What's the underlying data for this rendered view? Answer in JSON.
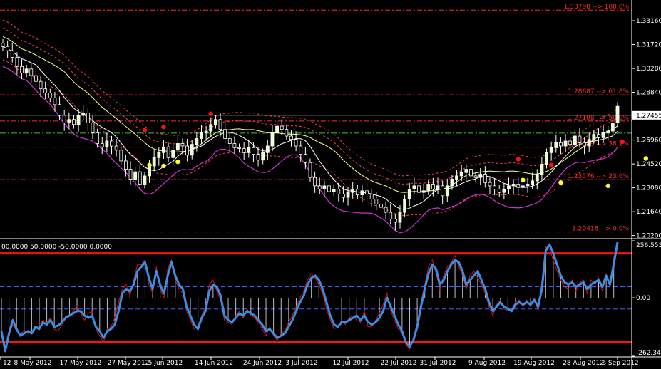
{
  "chart_data": [
    {
      "type": "candlestick",
      "panel": "price",
      "y_ticks": [
        "1.33160",
        "1.31720",
        "1.30280",
        "1.28840",
        "1.27455",
        "1.25960",
        "1.24520",
        "1.23080",
        "1.21640",
        "1.20200"
      ],
      "ylim": [
        1.201,
        1.3415
      ],
      "current_price": 1.27455,
      "fib_levels": [
        {
          "value": 1.33798,
          "label": "1.33798 --> 100.0%"
        },
        {
          "value": 1.28687,
          "label": "1.28687 --> 61.8%"
        },
        {
          "value": 1.27108,
          "label": "1.27108 --> 50.0%"
        },
        {
          "value": 1.25529,
          "label": "1.25529 --> 38.2%"
        },
        {
          "value": 1.23576,
          "label": "1.23576 --> 23.6%"
        },
        {
          "value": 1.20418,
          "label": "1.20418 --> 0.0%"
        }
      ],
      "close": [
        1.316,
        1.3135,
        1.3095,
        1.304,
        1.3,
        1.3025,
        1.2985,
        1.295,
        1.2905,
        1.288,
        1.285,
        1.281,
        1.2745,
        1.27,
        1.272,
        1.269,
        1.2745,
        1.276,
        1.27,
        1.264,
        1.2575,
        1.2555,
        1.259,
        1.256,
        1.2535,
        1.247,
        1.242,
        1.236,
        1.2405,
        1.233,
        1.238,
        1.244,
        1.249,
        1.252,
        1.2555,
        1.249,
        1.2535,
        1.2575,
        1.256,
        1.2505,
        1.257,
        1.2605,
        1.264,
        1.265,
        1.269,
        1.272,
        1.266,
        1.2605,
        1.2575,
        1.255,
        1.2545,
        1.252,
        1.255,
        1.251,
        1.2475,
        1.252,
        1.256,
        1.264,
        1.268,
        1.266,
        1.262,
        1.26,
        1.256,
        1.251,
        1.246,
        1.237,
        1.232,
        1.23,
        1.232,
        1.2285,
        1.23,
        1.227,
        1.225,
        1.228,
        1.23,
        1.2265,
        1.229,
        1.227,
        1.224,
        1.221,
        1.219,
        1.216,
        1.212,
        1.21,
        1.216,
        1.224,
        1.23,
        1.232,
        1.228,
        1.229,
        1.233,
        1.23,
        1.232,
        1.226,
        1.232,
        1.236,
        1.238,
        1.24,
        1.242,
        1.238,
        1.237,
        1.239,
        1.234,
        1.232,
        1.23,
        1.228,
        1.23,
        1.232,
        1.233,
        1.231,
        1.232,
        1.233,
        1.235,
        1.239,
        1.245,
        1.252,
        1.255,
        1.258,
        1.256,
        1.259,
        1.257,
        1.262,
        1.258,
        1.256,
        1.26,
        1.263,
        1.261,
        1.264,
        1.265,
        1.27,
        1.28
      ],
      "markers": {
        "red": [
          [
            30,
            1.2655
          ],
          [
            34,
            1.2675
          ],
          [
            44,
            1.2755
          ],
          [
            109,
            1.248
          ],
          [
            116,
            1.2445
          ],
          [
            131,
            1.2585
          ]
        ],
        "yellow": [
          [
            31,
            1.2445
          ],
          [
            34,
            1.244
          ],
          [
            37,
            1.2465
          ],
          [
            110,
            1.2355
          ],
          [
            118,
            1.234
          ],
          [
            128,
            1.232
          ],
          [
            136,
            1.2485
          ]
        ]
      }
    },
    {
      "type": "line",
      "panel": "indicator",
      "header": "00.0000 50.0000 -50.0000 0.0000",
      "y_ticks": [
        "256.553",
        "0.00",
        "-262.345"
      ],
      "ylim": [
        -262.345,
        256.553
      ],
      "levels": [
        200,
        50,
        -50,
        -200
      ],
      "values": [
        -150,
        -240,
        -160,
        -100,
        -140,
        -170,
        -160,
        -150,
        -160,
        -130,
        -140,
        -110,
        -120,
        -100,
        -130,
        -125,
        -110,
        -90,
        -80,
        -70,
        -60,
        -60,
        -80,
        -90,
        -80,
        -130,
        -150,
        -180,
        -150,
        -140,
        -120,
        -60,
        20,
        40,
        30,
        60,
        120,
        140,
        160,
        90,
        40,
        120,
        60,
        20,
        100,
        160,
        100,
        60,
        40,
        -40,
        -80,
        -120,
        -140,
        -90,
        -60,
        30,
        60,
        50,
        10,
        -80,
        -100,
        -110,
        -90,
        -70,
        -80,
        -60,
        -70,
        -80,
        -100,
        -120,
        -150,
        -140,
        -160,
        -180,
        -170,
        -160,
        -130,
        -100,
        -60,
        -20,
        10,
        60,
        90,
        100,
        80,
        40,
        -20,
        -80,
        -120,
        -130,
        -110,
        -110,
        -100,
        -90,
        -80,
        -100,
        -80,
        -110,
        -120,
        -110,
        -90,
        -60,
        0,
        -40,
        -80,
        -120,
        -150,
        -200,
        -220,
        -190,
        -130,
        -40,
        40,
        110,
        150,
        130,
        60,
        80,
        120,
        150,
        170,
        160,
        120,
        60,
        80,
        100,
        120,
        80,
        40,
        -20,
        -60,
        -40,
        -20,
        -40,
        -50,
        -60,
        -30,
        -20,
        -30,
        -20,
        -30,
        -10,
        -40,
        40,
        210,
        240,
        200,
        150,
        100,
        70,
        60,
        70,
        50,
        60,
        70,
        40,
        60,
        70,
        80,
        50,
        100,
        60,
        150,
        250
      ],
      "signal_values": [
        -170,
        -230,
        -170,
        -120,
        -150,
        -160,
        -150,
        -160,
        -150,
        -140,
        -120,
        -100,
        -110,
        -90,
        -140,
        -150,
        -120,
        -80,
        -80,
        -60,
        -40,
        -70,
        -100,
        -70,
        -60,
        -140,
        -170,
        -200,
        -140,
        -130,
        -90,
        -20,
        40,
        60,
        10,
        80,
        150,
        150,
        170,
        60,
        20,
        140,
        40,
        0,
        130,
        170,
        80,
        40,
        20,
        -60,
        -100,
        -140,
        -130,
        -80,
        -40,
        60,
        80,
        30,
        -10,
        -100,
        -110,
        -120,
        -80,
        -60,
        -90,
        -50,
        -80,
        -90,
        -110,
        -140,
        -170,
        -130,
        -170,
        -190,
        -160,
        -150,
        -110,
        -80,
        -40,
        0,
        30,
        80,
        110,
        90,
        60,
        20,
        -50,
        -100,
        -140,
        -130,
        -100,
        -120,
        -90,
        -80,
        -100,
        -110,
        -60,
        -130,
        -130,
        -100,
        -70,
        -30,
        20,
        -60,
        -100,
        -140,
        -160,
        -210,
        -230,
        -180,
        -110,
        -20,
        60,
        140,
        170,
        110,
        40,
        100,
        140,
        160,
        190,
        140,
        100,
        40,
        100,
        120,
        90,
        60,
        20,
        -40,
        -80,
        -30,
        -10,
        -50,
        -60,
        -50,
        -20,
        -10,
        -40,
        -10,
        -40,
        0,
        -60,
        80,
        230,
        220,
        170,
        120,
        80,
        50,
        40,
        80,
        30,
        70,
        80,
        20,
        80,
        60,
        90,
        30,
        110,
        50,
        180,
        240
      ]
    }
  ],
  "x_labels": [
    "12",
    "8 May 2012",
    "17 May 2012",
    "27 May 2012",
    "5 Jun 2012",
    "14 Jun 2012",
    "24 Jun 2012",
    "3 Jul 2012",
    "12 Jul 2012",
    "22 Jul 2012",
    "31 Jul 2012",
    "9 Aug 2012",
    "19 Aug 2012",
    "28 Aug 2012",
    "6 Sep 2012"
  ],
  "colors": {
    "background": "#000000",
    "axis": "#ffffff",
    "bull_candle": "#e8ffc8",
    "bear_candle": "#000000",
    "wick": "#ffffff",
    "ma_yellow": "#ffff88",
    "ma_white": "#ffffff",
    "envelope_dashed": "#ff4040",
    "magenta_band": "#d030d0",
    "fib_line": "#ff2a2a",
    "fib_green": "#40c040",
    "cci_line": "#3a8ee6",
    "signal_line": "#e01010",
    "level_thick": "#ff1010",
    "level_dashed": "#4060ff",
    "histogram": "#ffffff",
    "marker_red": "#ff1010",
    "marker_yellow": "#ffff20"
  }
}
